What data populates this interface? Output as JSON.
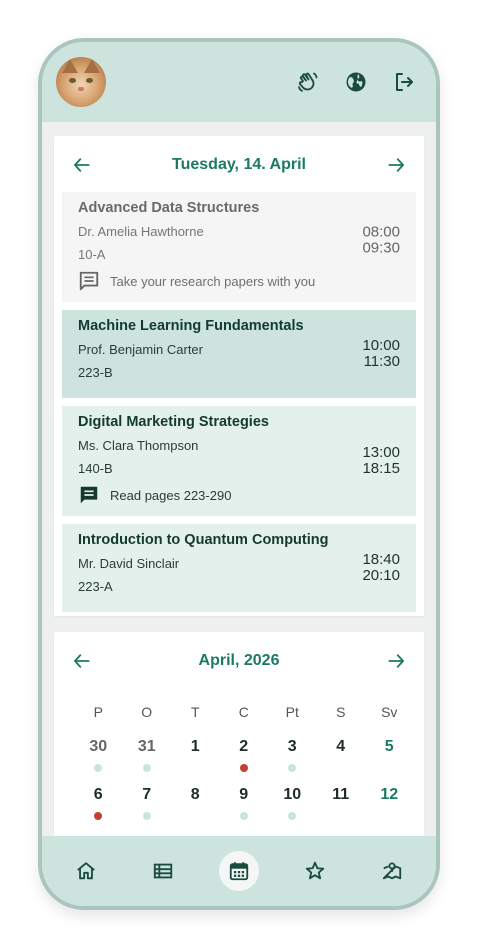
{
  "header": {
    "icons": [
      "waving-hand-icon",
      "globe-icon",
      "logout-icon"
    ]
  },
  "day_view": {
    "title": "Tuesday, 14. April",
    "lessons": [
      {
        "state": "past",
        "subject": "Advanced Data Structures",
        "teacher": "Dr. Amelia Hawthorne",
        "room": "10-A",
        "start": "08:00",
        "end": "09:30",
        "note": "Take your research papers with you"
      },
      {
        "state": "current",
        "subject": "Machine Learning Fundamentals",
        "teacher": "Prof. Benjamin Carter",
        "room": "223-B",
        "start": "10:00",
        "end": "11:30",
        "note": ""
      },
      {
        "state": "future",
        "subject": "Digital Marketing Strategies",
        "teacher": "Ms. Clara Thompson",
        "room": "140-B",
        "start": "13:00",
        "end": "18:15",
        "note": "Read pages 223-290"
      },
      {
        "state": "future",
        "subject": "Introduction to Quantum Computing",
        "teacher": "Mr. David Sinclair",
        "room": "223-A",
        "start": "18:40",
        "end": "20:10",
        "note": ""
      }
    ]
  },
  "calendar": {
    "title": "April, 2026",
    "weekdays": [
      "P",
      "O",
      "T",
      "C",
      "Pt",
      "S",
      "Sv"
    ],
    "weeks": [
      [
        {
          "d": "30",
          "type": "other",
          "dot": "green"
        },
        {
          "d": "31",
          "type": "other",
          "dot": "green"
        },
        {
          "d": "1",
          "type": "normal",
          "dot": ""
        },
        {
          "d": "2",
          "type": "normal",
          "dot": "red"
        },
        {
          "d": "3",
          "type": "normal",
          "dot": "green"
        },
        {
          "d": "4",
          "type": "normal",
          "dot": ""
        },
        {
          "d": "5",
          "type": "weekend",
          "dot": ""
        }
      ],
      [
        {
          "d": "6",
          "type": "normal",
          "dot": "red"
        },
        {
          "d": "7",
          "type": "normal",
          "dot": "green"
        },
        {
          "d": "8",
          "type": "normal",
          "dot": ""
        },
        {
          "d": "9",
          "type": "normal",
          "dot": "green"
        },
        {
          "d": "10",
          "type": "normal",
          "dot": "green"
        },
        {
          "d": "11",
          "type": "normal",
          "dot": ""
        },
        {
          "d": "12",
          "type": "weekend",
          "dot": ""
        }
      ]
    ]
  },
  "bottom_nav": {
    "tabs": [
      "home-icon",
      "list-icon",
      "calendar-icon",
      "star-icon",
      "map-icon"
    ],
    "active": "calendar-icon"
  },
  "colors": {
    "accent": "#1b7a63",
    "bar": "#cde4de",
    "alert_dot": "#c0432f"
  }
}
